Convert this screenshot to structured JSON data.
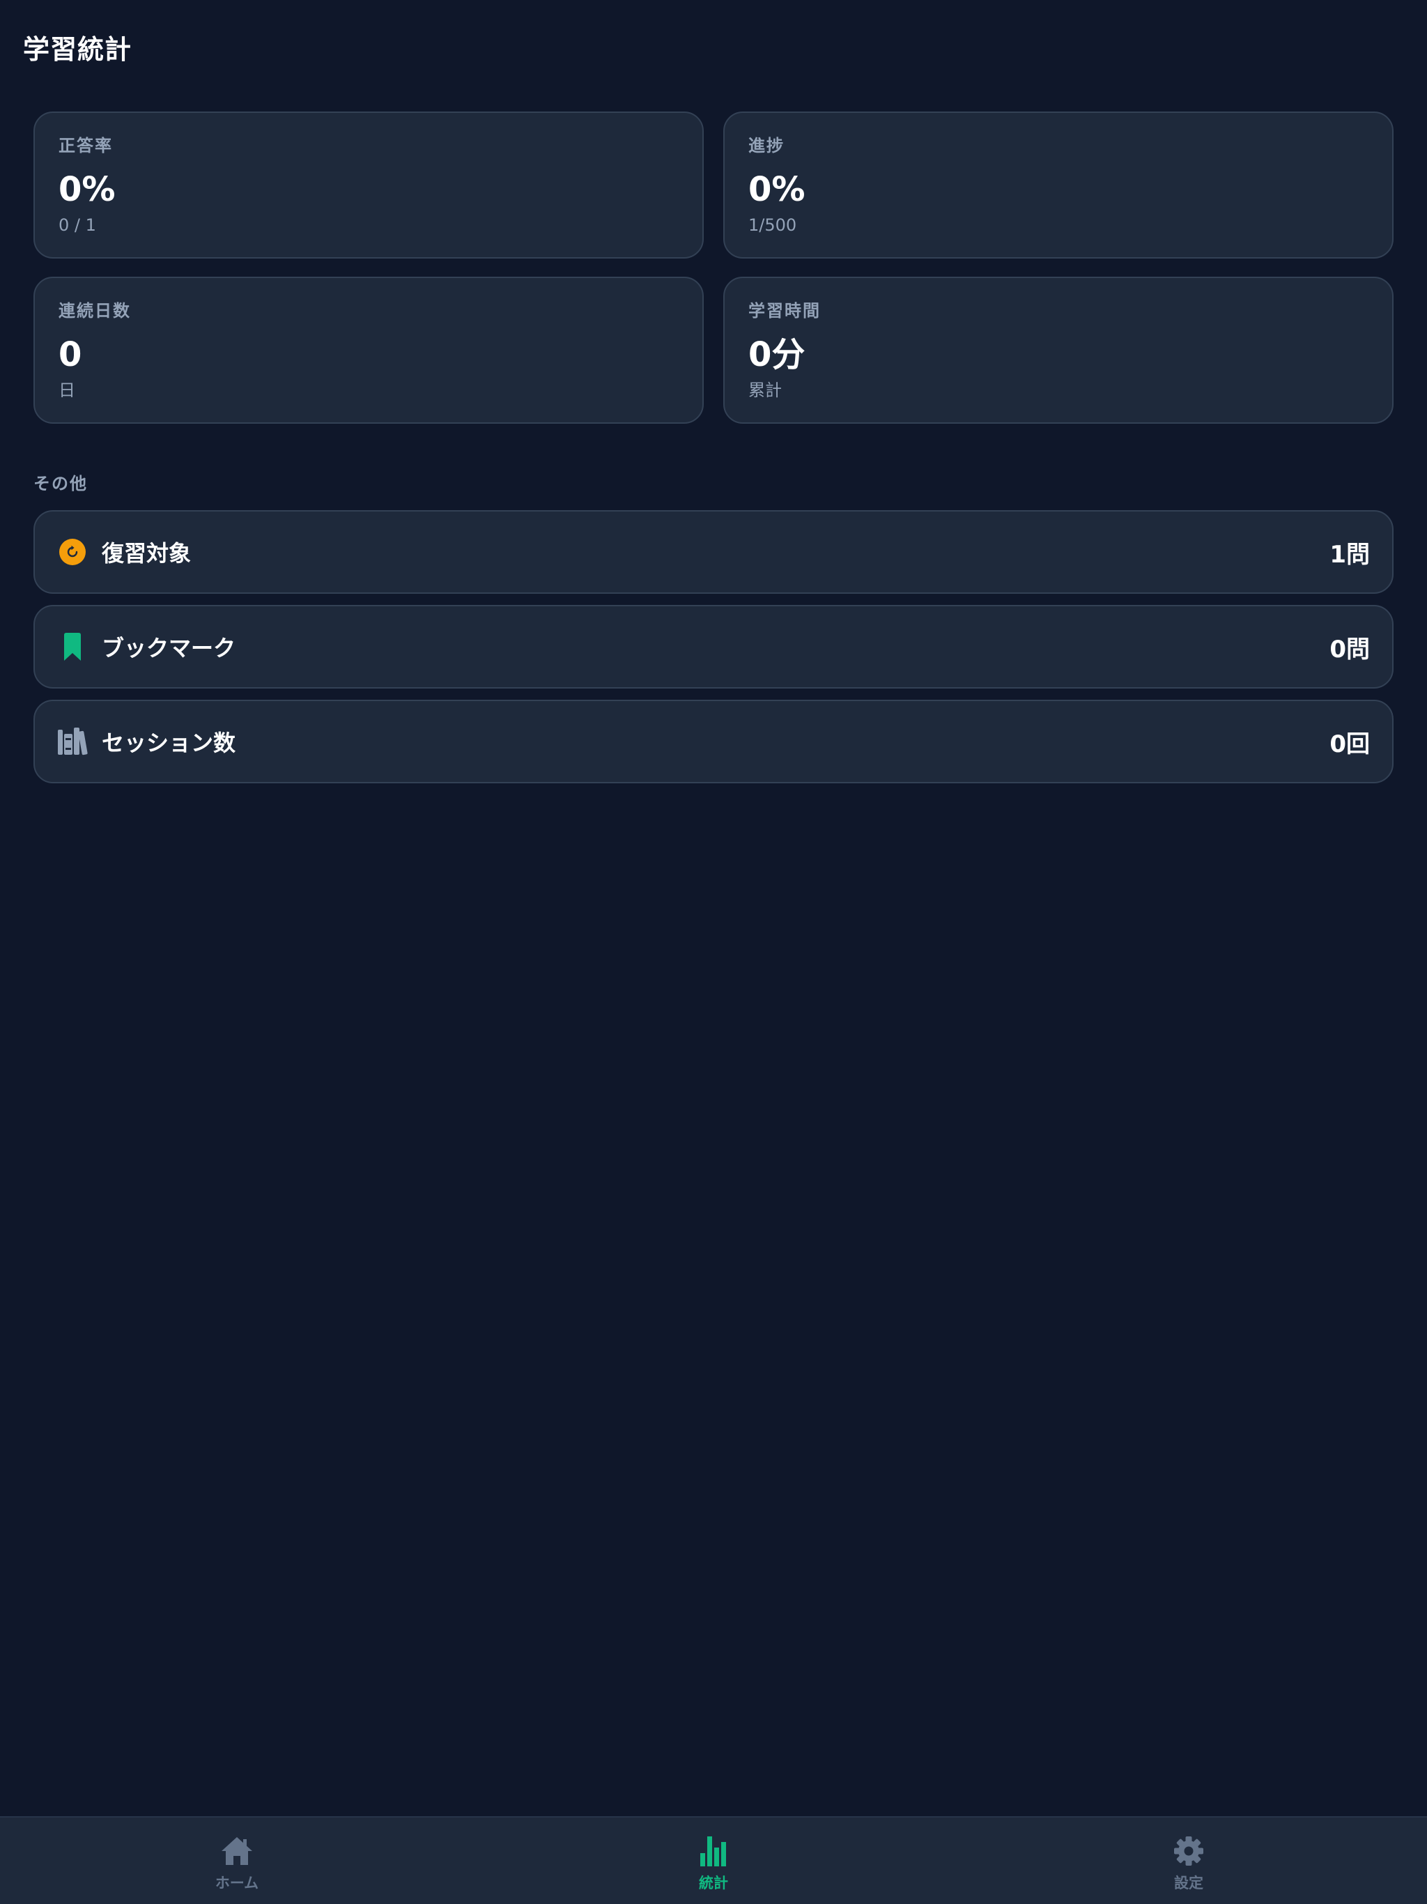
{
  "header": {
    "title": "学習統計"
  },
  "stats": [
    {
      "label": "正答率",
      "value": "0%",
      "sub": "0 / 1"
    },
    {
      "label": "進捗",
      "value": "0%",
      "sub": "1/500"
    },
    {
      "label": "連続日数",
      "value": "0",
      "sub": "日"
    },
    {
      "label": "学習時間",
      "value": "0分",
      "sub": "累計"
    }
  ],
  "other": {
    "title": "その他",
    "items": [
      {
        "icon": "review-refresh-icon",
        "label": "復習対象",
        "value": "1問"
      },
      {
        "icon": "bookmark-icon",
        "label": "ブックマーク",
        "value": "0問"
      },
      {
        "icon": "books-icon",
        "label": "セッション数",
        "value": "0回"
      }
    ]
  },
  "tabbar": {
    "tabs": [
      {
        "icon": "home-icon",
        "label": "ホーム",
        "active": false
      },
      {
        "icon": "bar-chart-icon",
        "label": "統計",
        "active": true
      },
      {
        "icon": "gear-icon",
        "label": "設定",
        "active": false
      }
    ]
  },
  "colors": {
    "background": "#0f172a",
    "card": "#1e293b",
    "border": "#334155",
    "muted_text": "#94a3b8",
    "accent": "#10b981",
    "review_orange": "#f59e0b",
    "inactive_tab": "#64748b"
  }
}
